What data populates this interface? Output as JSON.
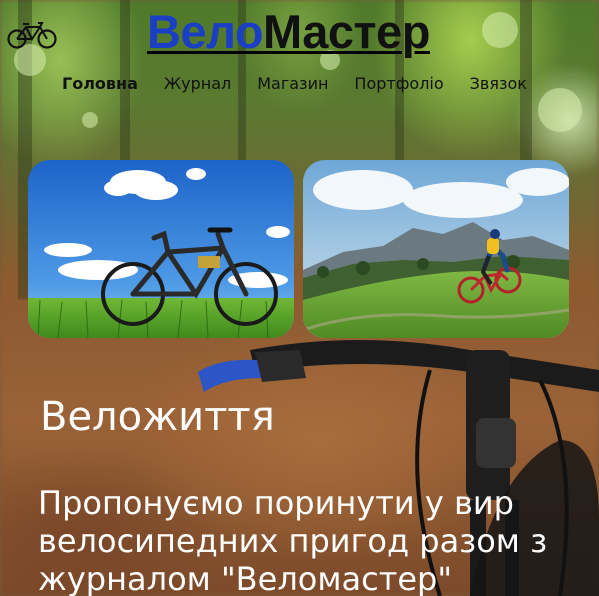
{
  "header": {
    "logo_icon": "bicycle-icon",
    "brand_part1": "Вело",
    "brand_part2": "Мастер",
    "brand_colors": {
      "part1": "#1a3fc4",
      "part2": "#111111"
    }
  },
  "nav": {
    "items": [
      {
        "label": "Головна",
        "active": true
      },
      {
        "label": "Журнал",
        "active": false
      },
      {
        "label": "Магазин",
        "active": false
      },
      {
        "label": "Портфоліо",
        "active": false
      },
      {
        "label": "Звязок",
        "active": false
      }
    ]
  },
  "gallery": {
    "photos": [
      {
        "subject": "mountain bike standing on green grass under blue sky"
      },
      {
        "subject": "cyclist riding red bike on grassy hill with mountains"
      }
    ]
  },
  "hero": {
    "title": "Веложиття",
    "text": "Пропонуємо поринути у вир велосипедних пригод разом з журналом \"Веломастер\""
  }
}
